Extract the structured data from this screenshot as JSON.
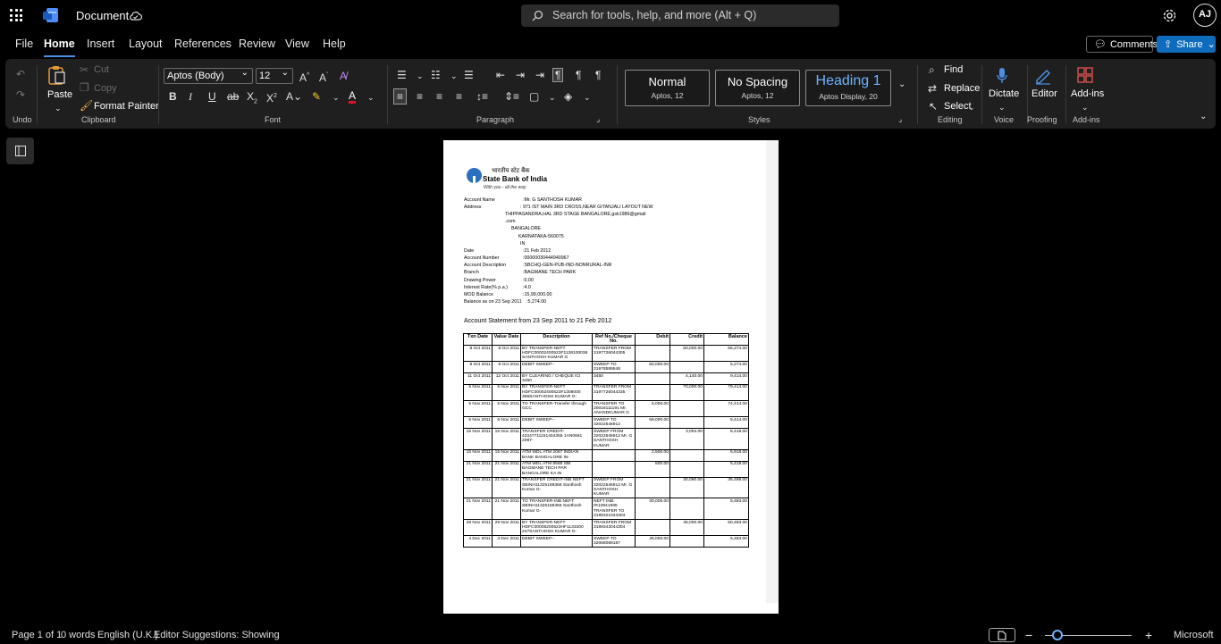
{
  "app": {
    "doc_title": "Document"
  },
  "search": {
    "placeholder": "Search for tools, help, and more (Alt + Q)"
  },
  "user": {
    "initials": "AJ"
  },
  "menu": {
    "tabs": [
      "File",
      "Home",
      "Insert",
      "Layout",
      "References",
      "Review",
      "View",
      "Help"
    ],
    "comments": "Comments",
    "share": "Share"
  },
  "ribbon": {
    "undo_label": "Undo",
    "clipboard": {
      "paste": "Paste",
      "cut": "Cut",
      "copy": "Copy",
      "format_painter": "Format Painter",
      "label": "Clipboard"
    },
    "font": {
      "family": "Aptos (Body)",
      "size": "12",
      "label": "Font"
    },
    "paragraph": {
      "label": "Paragraph"
    },
    "styles": {
      "label": "Styles",
      "items": [
        {
          "name": "Normal",
          "sub": "Aptos, 12"
        },
        {
          "name": "No Spacing",
          "sub": "Aptos, 12"
        },
        {
          "name": "Heading 1",
          "sub": "Aptos Display, 20"
        }
      ]
    },
    "editing": {
      "find": "Find",
      "replace": "Replace",
      "select": "Select",
      "label": "Editing"
    },
    "voice": {
      "dictate": "Dictate",
      "label": "Voice"
    },
    "proofing": {
      "editor": "Editor",
      "label": "Proofing"
    },
    "addins": {
      "addins": "Add-ins",
      "label": "Add-ins"
    }
  },
  "colors": {
    "accent": "#0f6cbd",
    "heading": "#6cb4ff",
    "ribbon_bg": "#1f1f1f"
  },
  "document": {
    "bank_hindi": "भारतीय स्टेट बैंक",
    "bank_name": "State Bank of India",
    "bank_tagline": "With you - all the way",
    "fields": [
      {
        "k": "Account Name",
        "v": ":Mr. G SANTHOSH  KUMAR"
      },
      {
        "k": "Address",
        "v": ": 971 IST MAIN 3RD CROSS,NEAR GITANJALI LAYOUT NEW"
      },
      {
        "k": "Date",
        "v": ":21 Feb 2012"
      },
      {
        "k": "Account Number",
        "v": ":00000030444940967"
      },
      {
        "k": "Account Description",
        "v": ":SBCHQ-GEN-PUB-IND-NONRURAL-INR"
      },
      {
        "k": "Branch",
        "v": ":BAGMANE TECH PARK"
      },
      {
        "k": "Drawing Power",
        "v": ":0.00"
      },
      {
        "k": "Interest Rate(% p.a.)",
        "v": ":4.0"
      },
      {
        "k": "MOD Balance",
        "v": ":15,99,000.00"
      },
      {
        "k": "Balance as on 23 Sep 2011",
        "v": ":5,274.00"
      }
    ],
    "address_lines": [
      "THIPPASANDRA,HAL 3RD STAGE BANGALORE,gsk1986@gmail",
      ".com",
      "BANGALORE",
      "KARNATAKA-560075",
      "IN"
    ],
    "statement_title": "Account Statement from 23 Sep 2011 to 21 Feb 2012",
    "columns": [
      "Txn Date",
      "Value Date",
      "Description",
      "Ref No./Cheque No.",
      "Debit",
      "Credit",
      "Balance"
    ],
    "rows": [
      [
        "8 Oct 2011",
        "8 Oct 2011",
        "BY TRANSFER-NEFT HDFC00002400523F1128100036 SANTHOSH KUMAR G",
        "TRANSFER FROM 3197726044305",
        "",
        "50,000.00",
        "55,274.00"
      ],
      [
        "9 Oct 2011",
        "9 Oct 2011",
        "DEBIT SWEEP--",
        "SWEEP TO 31978589548",
        "50,000.00",
        "",
        "5,274.00"
      ],
      [
        "11 Oct 2011",
        "12 Oct 2011",
        "BY CLEARING / CHEQUE ICI 3450",
        "3450",
        "",
        "4,140.00",
        "9,414.00"
      ],
      [
        "5 Nov 2011",
        "5 Nov 2011",
        "BY TRANSFER-NEFT HDFC00002400523F1308000 365SANTHOSH KUMAR G-",
        "TRANSFER FROM 3197726044335",
        "",
        "70,000.00",
        "79,414.00"
      ],
      [
        "5 Nov 2011",
        "5 Nov 2011",
        "TO TRANSFER-Transfer through GCC",
        "TRANSFER TO 20018111191 Mr. ANANDKUMAR G",
        "5,000.00",
        "",
        "74,414.00"
      ],
      [
        "6 Nov 2011",
        "6 Nov 2011",
        "DEBIT SWEEP--",
        "SWEEP TO 32022546912",
        "69,000.00",
        "",
        "5,414.00"
      ],
      [
        "15 Nov 2011",
        "15 Nov 2011",
        "TRANSFER CREDIT-42247711151404355 1AN0661 2087-",
        "SWEEP FROM 32022546912 Mr. G SANTHOSH KUMAR",
        "",
        "3,004.00",
        "8,418.00"
      ],
      [
        "15 Nov 2011",
        "15 Nov 2011",
        "ATM WDL ATM 2087  INDIAN BANK        BANGALORE IN-",
        "",
        "2,500.00",
        "",
        "5,918.00"
      ],
      [
        "21 Nov 2011",
        "21 Nov 2011",
        "ATM WDL ATM 9568  SBI BAGMANE TECH PAR BANGALORE     KA IN",
        "",
        "500.00",
        "",
        "5,418.00"
      ],
      [
        "21 Nov 2011",
        "21 Nov 2011",
        "TRANSFER CREDIT-INB NEFT SBINH11325168366 Santhosh Kumar  G-",
        "SWEEP FROM 32022546912 Mr. G SANTHOSH KUMAR",
        "",
        "30,080.00",
        "35,498.00"
      ],
      [
        "21 Nov 2011",
        "21 Nov 2011",
        "TO TRANSFER-INB NEFT SBINH11325168366 Santhosh Kumar  G-",
        "NEFT INB: IR10941695 TRANSFER TO 3199321044303",
        "30,005.00",
        "",
        "5,493.00"
      ],
      [
        "29 Nov 2011",
        "29 Nov 2011",
        "BY TRANSFER-NEFT HDFC00005200523HF1133300 247SANTHOSH KUMAR G-",
        "TRANSFER FROM 3199343044304",
        "",
        "45,000.00",
        "50,493.00"
      ],
      [
        "4 Dec 2011",
        "4 Dec 2011",
        "DEBIT SWEEP--",
        "SWEEP TO 32068089187",
        "45,000.00",
        "",
        "5,493.00"
      ]
    ]
  },
  "status": {
    "page": "Page 1 of 1",
    "words": "0 words",
    "language": "English (U.K.)",
    "editor": "Editor Suggestions: Showing",
    "zoom_minus": "−",
    "zoom_plus": "+",
    "brand": "Microsoft"
  }
}
